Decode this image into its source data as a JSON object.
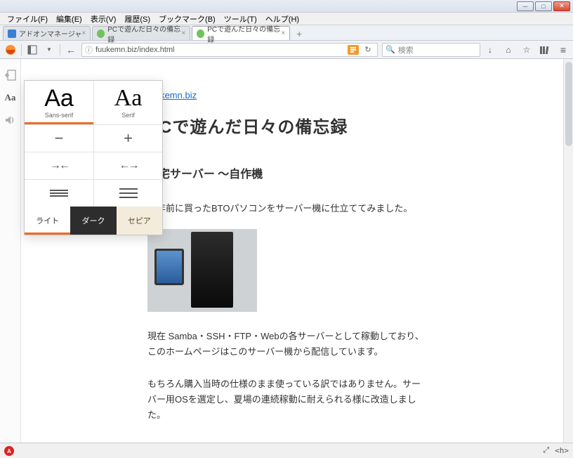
{
  "menubar": {
    "file": "ファイル(F)",
    "edit": "編集(E)",
    "view": "表示(V)",
    "history": "履歴(S)",
    "bookmarks": "ブックマーク(B)",
    "tools": "ツール(T)",
    "help": "ヘルプ(H)"
  },
  "tabs": [
    {
      "title": "アドオンマネージャ",
      "favicon_color": "#3b7fd4"
    },
    {
      "title": "PCで遊んだ日々の備忘録",
      "favicon_color": "#6fc35a"
    },
    {
      "title": "PCで遊んだ日々の備忘録",
      "favicon_color": "#6fc35a"
    }
  ],
  "active_tab_index": 2,
  "url": "fuukemn.biz/index.html",
  "searchbox_placeholder": "検索",
  "reader_panel": {
    "sans_label": "Sans-serif",
    "serif_label": "Serif",
    "selected_font": "sans",
    "themes": {
      "light": "ライト",
      "dark": "ダーク",
      "sepia": "セピア"
    },
    "selected_theme": "light"
  },
  "article": {
    "site_link": "fuukemn.biz",
    "title": "PCで遊んだ日々の備忘録",
    "heading": "自宅サーバー ～自作機",
    "p1": "数年前に買ったBTOパソコンをサーバー機に仕立ててみました。",
    "p2": "現在 Samba・SSH・FTP・Webの各サーバーとして稼動しており、このホームページはこのサーバー機から配信しています。",
    "p3": "もちろん購入当時の仕様のまま使っている訳ではありません。サーバー用OSを選定し、夏場の連続稼動に耐えられる様に改造しました。"
  },
  "statusbar": {
    "tag_label": "<h>"
  }
}
